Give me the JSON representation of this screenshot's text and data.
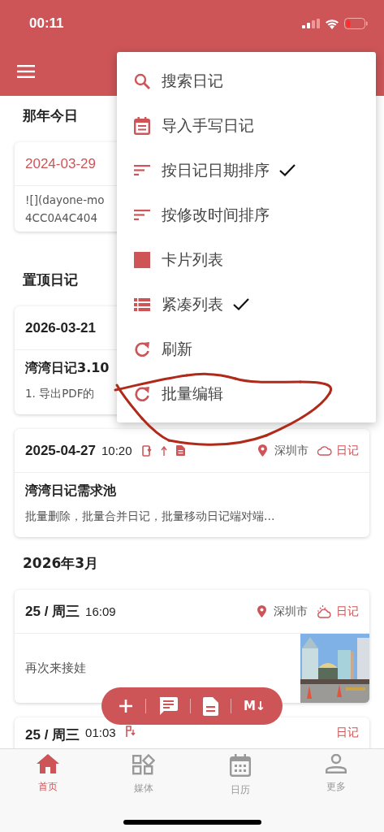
{
  "status_bar": {
    "time": "00:11"
  },
  "sections": [
    {
      "title": "那年今日",
      "entries": [
        {
          "kind": "memory",
          "date": "2024-03-29",
          "lines": [
            "![](dayone-mo",
            "4CC0A4C404"
          ]
        }
      ]
    },
    {
      "title": "置顶日记",
      "entries": [
        {
          "kind": "entry",
          "date": "2026-03-21",
          "title": "湾湾日记3.10",
          "preview": "1. 导出PDF的"
        }
      ]
    },
    {
      "entries": [
        {
          "kind": "entry",
          "date": "2025-04-27",
          "time": "10:20",
          "location": "深圳市",
          "tag": "日记",
          "title": "湾湾日记需求池",
          "preview": "批量删除，批量合并日记，批量移动日记端对端…"
        }
      ]
    },
    {
      "title": "2026年3月",
      "entries": [
        {
          "date": "25 / 周三",
          "time": "16:09",
          "location": "深圳市",
          "tag": "日记",
          "preview": "再次来接娃"
        },
        {
          "kind": "entry",
          "date": "25 / 周三",
          "time": "01:03",
          "tag": "日记"
        }
      ]
    }
  ],
  "menu": [
    {
      "label": "搜索日记",
      "checked": false
    },
    {
      "label": "导入手写日记",
      "checked": false
    },
    {
      "label": "按日记日期排序",
      "checked": true
    },
    {
      "label": "按修改时间排序",
      "checked": false
    },
    {
      "label": "卡片列表",
      "checked": false
    },
    {
      "label": "紧凑列表",
      "checked": true
    },
    {
      "label": "刷新",
      "checked": false
    },
    {
      "label": "批量编辑",
      "checked": false
    }
  ],
  "fab": {
    "markdown_label": "M↓"
  },
  "nav": [
    {
      "label": "首页",
      "selected": true
    },
    {
      "label": "媒体",
      "selected": false
    },
    {
      "label": "日历",
      "selected": false
    },
    {
      "label": "更多",
      "selected": false
    }
  ]
}
